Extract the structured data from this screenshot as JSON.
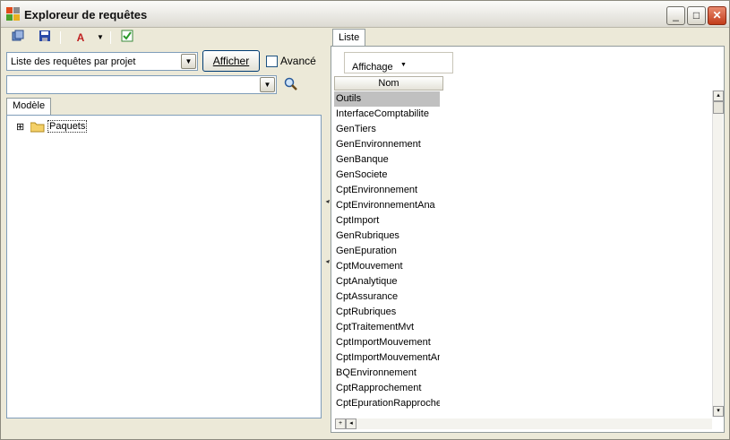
{
  "window": {
    "title": "Exploreur de requêtes",
    "controls": {
      "minimize": "_",
      "maximize": "□",
      "close": "✕"
    }
  },
  "toolbar": {
    "icons": [
      "copy-icon",
      "save-icon",
      "font-icon",
      "dropdown-arrow-icon",
      "check-icon"
    ],
    "font_glyph": "A"
  },
  "query_select": {
    "value": "Liste des requêtes par projet"
  },
  "afficher_button": {
    "label": "Afficher"
  },
  "avance": {
    "label": "Avancé",
    "checked": false
  },
  "search": {
    "value": ""
  },
  "left_tab": {
    "label": "Modèle"
  },
  "tree": {
    "expander": "⊞",
    "root_label": "Paquets"
  },
  "right_tab": {
    "label": "Liste"
  },
  "view_button": {
    "label": "Affichage",
    "arrow": "▼"
  },
  "grid": {
    "column_header": "Nom",
    "rows": [
      "Outils",
      "InterfaceComptabilite",
      "GenTiers",
      "GenEnvironnement",
      "GenBanque",
      "GenSociete",
      "CptEnvironnement",
      "CptEnvironnementAna",
      "CptImport",
      "GenRubriques",
      "GenEpuration",
      "CptMouvement",
      "CptAnalytique",
      "CptAssurance",
      "CptRubriques",
      "CptTraitementMvt",
      "CptImportMouvement",
      "CptImportMouvementAna",
      "BQEnvironnement",
      "CptRapprochement",
      "CptEpurationRapprochement"
    ],
    "selected_index": 0
  },
  "scroll": {
    "plus": "+",
    "left": "◂",
    "up": "▴",
    "down": "▾"
  },
  "colors": {
    "selected_row": "#c0c0c0",
    "panel_border": "#7f9db9"
  }
}
